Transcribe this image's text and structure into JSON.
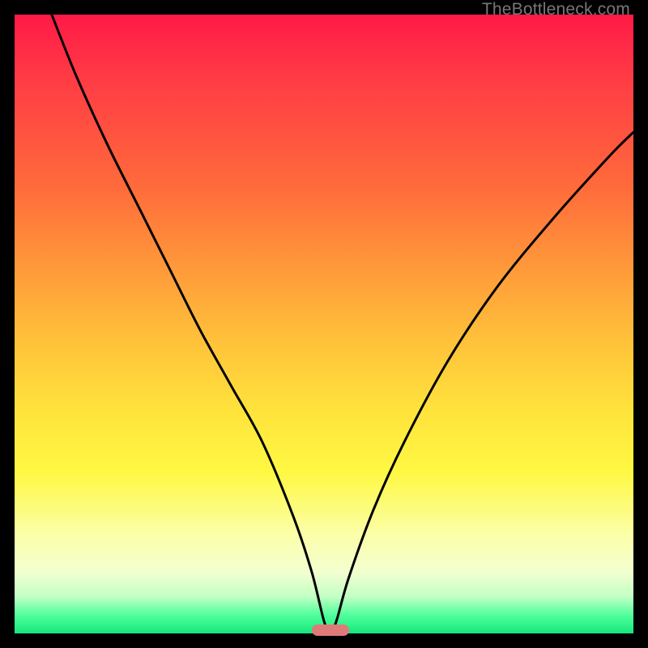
{
  "watermark": "TheBottleneck.com",
  "colors": {
    "frame": "#000000",
    "curve": "#000000",
    "blob": "#e07a78",
    "watermark": "#777777"
  },
  "chart_data": {
    "type": "line",
    "title": "",
    "xlabel": "",
    "ylabel": "",
    "xlim": [
      0,
      100
    ],
    "ylim": [
      0,
      100
    ],
    "grid": false,
    "note": "No axis ticks or numeric labels are visible; values are read as percentage of plot width/height.",
    "series": [
      {
        "name": "bottleneck-curve",
        "x": [
          6,
          10,
          15,
          20,
          25,
          30,
          35,
          40,
          45,
          48,
          50,
          51,
          52,
          54,
          58,
          63,
          70,
          78,
          87,
          96,
          100
        ],
        "y": [
          100,
          90,
          79,
          69,
          59,
          49,
          40,
          31,
          19,
          10,
          2,
          0,
          2,
          9,
          20,
          31,
          44,
          56,
          67,
          77,
          81
        ]
      }
    ],
    "marker": {
      "name": "optimal-point",
      "x": 51,
      "y": 0,
      "shape": "rounded-rect",
      "color": "#e07a78"
    }
  }
}
